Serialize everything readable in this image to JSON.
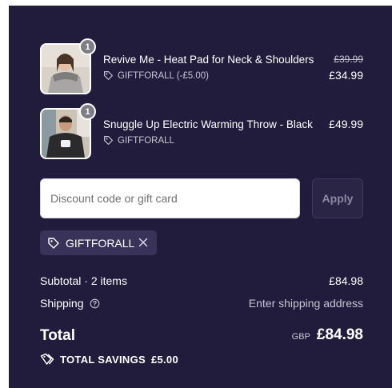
{
  "items": [
    {
      "quantity": "1",
      "name": "Revive Me - Heat Pad for Neck & Shoulders",
      "discount_code": "GIFTFORALL (-£5.00)",
      "original_price": "£39.99",
      "price": "£34.99",
      "icon": "tag-icon"
    },
    {
      "quantity": "1",
      "name": "Snuggle Up Electric Warming Throw - Black",
      "discount_code": "GIFTFORALL",
      "price": "£49.99",
      "icon": "tag-icon"
    }
  ],
  "discount": {
    "placeholder": "Discount code or gift card",
    "apply_label": "Apply",
    "applied_code": "GIFTFORALL"
  },
  "summary": {
    "subtotal_label": "Subtotal · 2 items",
    "subtotal_value": "£84.98",
    "shipping_label": "Shipping",
    "shipping_value": "Enter shipping address",
    "total_label": "Total",
    "currency": "GBP",
    "total_value": "£84.98",
    "savings_label": "TOTAL SAVINGS",
    "savings_value": "£5.00"
  },
  "colors": {
    "panel_bg": "#211b3c",
    "tag_bg": "#3a3359",
    "muted_text": "#c7c4d3"
  }
}
